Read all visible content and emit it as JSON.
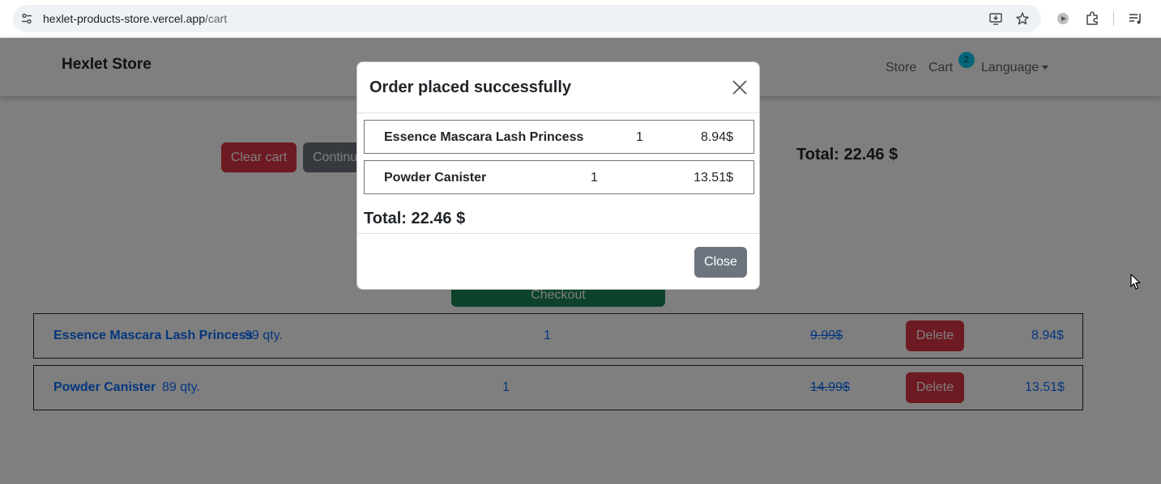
{
  "browser": {
    "url_host": "hexlet-products-store.vercel.app",
    "url_path": "/cart"
  },
  "navbar": {
    "brand": "Hexlet Store",
    "links": {
      "store": "Store",
      "cart": "Cart",
      "language": "Language"
    },
    "cart_count": "2"
  },
  "toolbar": {
    "clear_cart": "Clear cart",
    "continue": "Continue shopping",
    "checkout": "Checkout"
  },
  "cart": {
    "total": "Total: 22.46 $",
    "delete_label": "Delete",
    "items": [
      {
        "name": "Essence Mascara Lash Princess",
        "stock": "99 qty.",
        "quantity": "1",
        "old_price": "9.99$",
        "price": "8.94$"
      },
      {
        "name": "Powder Canister",
        "stock": "89 qty.",
        "quantity": "1",
        "old_price": "14.99$",
        "price": "13.51$"
      }
    ]
  },
  "modal": {
    "title": "Order placed successfully",
    "items": [
      {
        "name": "Essence Mascara Lash Princess",
        "quantity": "1",
        "price": "8.94$"
      },
      {
        "name": "Powder Canister",
        "quantity": "1",
        "price": "13.51$"
      }
    ],
    "total": "Total: 22.46 $",
    "close_label": "Close"
  },
  "colors": {
    "danger": "#dc3545",
    "secondary": "#6c757d",
    "success": "#198754",
    "link": "#0d6efd",
    "badge": "#0dcaf0"
  }
}
